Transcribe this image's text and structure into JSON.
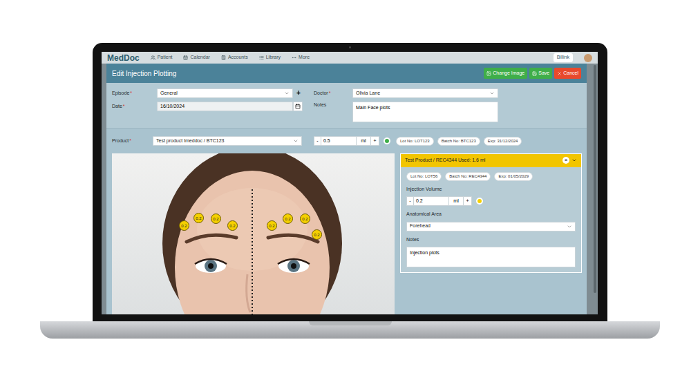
{
  "app": {
    "logo": "MedDoc",
    "nav": [
      "Patient",
      "Calendar",
      "Accounts",
      "Library",
      "More"
    ],
    "user_button": "Billink"
  },
  "modal": {
    "title": "Edit Injection Plotting",
    "buttons": [
      {
        "label": "Change Image",
        "kind": "image",
        "color": "#3fae49"
      },
      {
        "label": "Save",
        "kind": "save",
        "color": "#3fae49"
      },
      {
        "label": "Cancel",
        "kind": "cancel",
        "color": "#e8492c"
      }
    ]
  },
  "form": {
    "required_mark": "*",
    "episode": {
      "label": "Episode",
      "required": true,
      "value": "General",
      "add": "+"
    },
    "date": {
      "label": "Date",
      "required": true,
      "value": "16/10/2024"
    },
    "doctor": {
      "label": "Doctor",
      "required": true,
      "value": "Olivia Lane"
    },
    "notes": {
      "label": "Notes",
      "required": false,
      "value": "Main Face plots"
    }
  },
  "product": {
    "label": "Product",
    "required": true,
    "value": "Test product Imeddoc / BTC123",
    "minus": "-",
    "volume": "0.5",
    "unit": "ml",
    "plus": "+",
    "color": "#3fae49",
    "badges": [
      "Lot No: LOT123",
      "Batch No: BTC123",
      "Exp: 31/12/2024"
    ]
  },
  "plot": {
    "pins": [
      {
        "volume": "0.2",
        "color": "#f5d000"
      },
      {
        "volume": "0.2",
        "color": "#f5d000"
      },
      {
        "volume": "0.2",
        "color": "#f5d000"
      },
      {
        "volume": "0.2",
        "color": "#f5d000"
      },
      {
        "volume": "0.2",
        "color": "#f5d000"
      },
      {
        "volume": "0.2",
        "color": "#f5d000"
      },
      {
        "volume": "0.2",
        "color": "#f5d000"
      },
      {
        "volume": "0.2",
        "color": "#f5d000"
      }
    ]
  },
  "panel": {
    "header": "Test Product / REC4344 Used: 1.6 ml",
    "color": "#f2c500",
    "close": "×",
    "expanded": true,
    "badges": [
      "Lot No: LOT56",
      "Batch No: REC4344",
      "Exp: 01/05/2029"
    ],
    "volume_label": "Injection Volume",
    "minus": "-",
    "volume": "0.2",
    "unit": "ml",
    "plus": "+",
    "area_label": "Anatomical Area",
    "area": "Forehead",
    "notes_label": "Notes",
    "notes": "Injection plots"
  }
}
